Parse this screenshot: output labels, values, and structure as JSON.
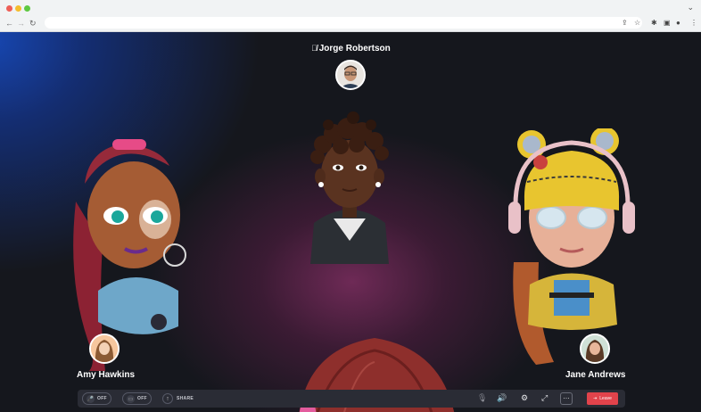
{
  "call": {
    "host": {
      "name": "Jorge Robertson",
      "mic_icon": "mic-off-icon"
    },
    "participants": [
      {
        "name": "Amy Hawkins"
      },
      {
        "name": "Jane Andrews"
      }
    ]
  },
  "controls": {
    "mic": {
      "label": "OFF",
      "icon": "mic-icon"
    },
    "camera": {
      "label": "OFF",
      "icon": "camera-icon"
    },
    "share": {
      "label": "SHARE",
      "icon": "arrow-up-icon"
    },
    "leave": {
      "label": "Leave",
      "icon": "exit-icon"
    }
  },
  "colors": {
    "leave": "#e2434b",
    "bar": "#2a2c35",
    "backdrop_blue": "#1746b0",
    "backdrop_magenta": "#6e2a56"
  }
}
